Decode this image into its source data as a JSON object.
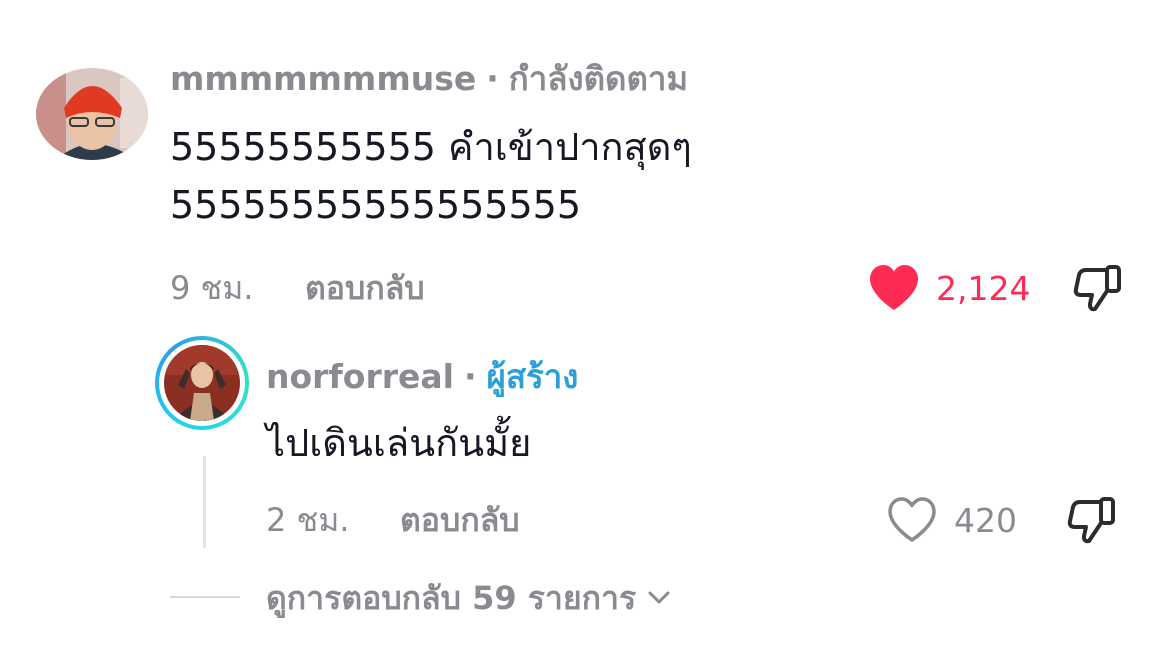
{
  "comment": {
    "username": "mmmmmmmuse",
    "separator": "·",
    "follow_status": "กำลังติดตาม",
    "text": "55555555555 คำเข้าปากสุดๆ\n55555555555555555",
    "time": "9 ชม.",
    "reply_label": "ตอบกลับ",
    "like_count": "2,124",
    "liked": true,
    "like_color": "#fe2c55",
    "avatar_icon": "user-avatar-red-beanie"
  },
  "reply": {
    "username": "norforreal",
    "separator": "·",
    "badge": "ผู้สร้าง",
    "badge_color": "#2a9fd8",
    "text": "ไปเดินเล่นกันมั้ย",
    "time": "2 ชม.",
    "reply_label": "ตอบกลับ",
    "like_count": "420",
    "liked": false,
    "avatar_icon": "creator-avatar-ring"
  },
  "view_replies": {
    "label": "ดูการตอบกลับ 59 รายการ",
    "icon": "chevron-down-icon"
  }
}
